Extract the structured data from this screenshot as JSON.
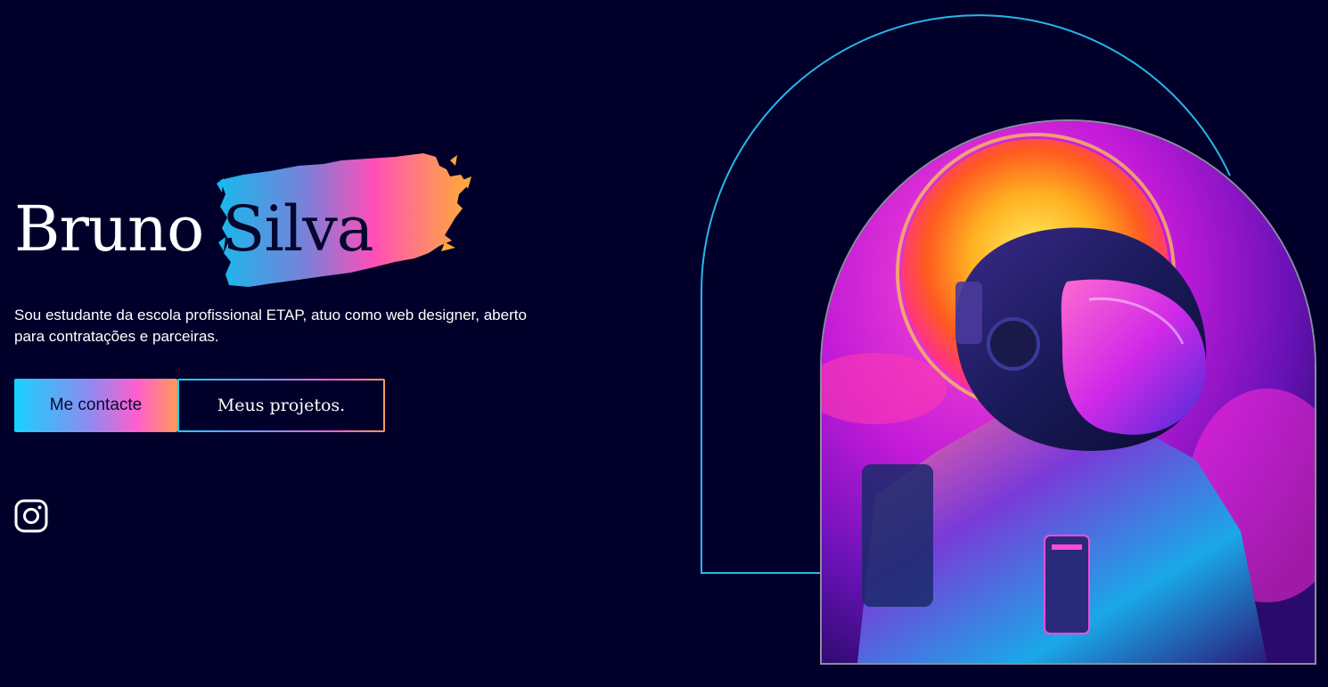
{
  "hero": {
    "first_name": "Bruno",
    "last_name": "Silva",
    "description": "Sou estudante da escola profissional ETAP, atuo como web designer, aberto para contratações e parceiras.",
    "primary_button": "Me contacte",
    "secondary_button": "Meus projetos."
  },
  "social": {
    "icons": [
      "instagram-icon"
    ]
  },
  "image": {
    "subject": "astronaut-illustration"
  },
  "colors": {
    "background": "#00002a",
    "arch_outline": "#29b6e8",
    "gradient_start": "#19d1ff",
    "gradient_mid": "#ff5ed0",
    "gradient_end": "#ff9a5a",
    "text": "#ffffff"
  }
}
